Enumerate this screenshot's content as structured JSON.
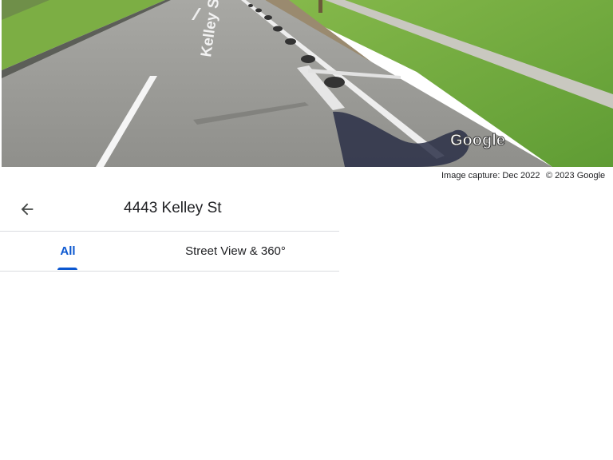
{
  "photo": {
    "street_sign_text": "Kelley St",
    "watermark": "Google",
    "colors": {
      "grass": "#6fae3c",
      "road": "#9b9b97",
      "marking": "#f5f5f5"
    }
  },
  "caption": {
    "capture_date": "Image capture: Dec 2022",
    "copyright": "© 2023 Google"
  },
  "header": {
    "back_icon": "arrow-left-icon",
    "title": "4443 Kelley St"
  },
  "tabs": [
    {
      "label": "All",
      "selected": true
    },
    {
      "label": "Street View & 360°",
      "selected": false
    }
  ],
  "colors": {
    "accent": "#0b57d0",
    "divider": "#dadce0",
    "text": "#202124"
  }
}
